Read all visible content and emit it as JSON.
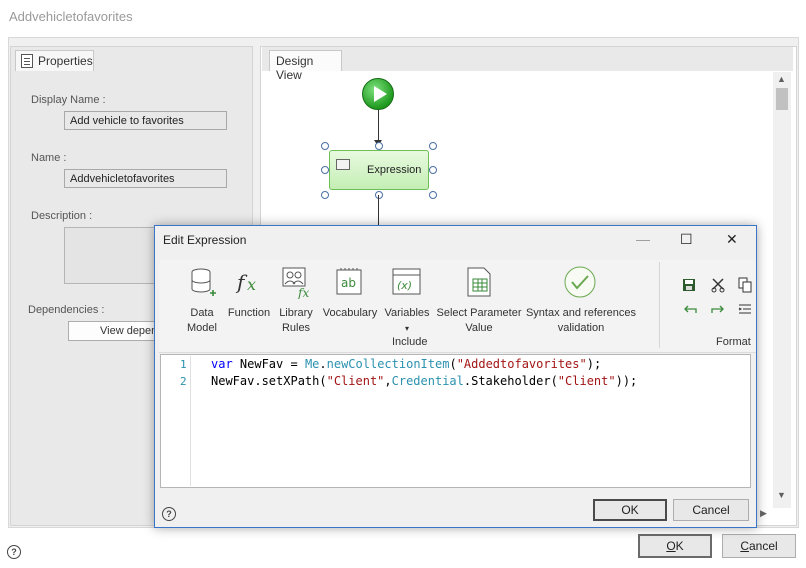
{
  "window": {
    "title": "Addvehicletofavorites",
    "ok_label": "OK",
    "ok_accel": "O",
    "ok_rest": "K",
    "cancel_label": "Cancel",
    "cancel_accel": "C",
    "cancel_rest": "ancel",
    "help_label": "?"
  },
  "properties": {
    "tab_label": "Properties",
    "display_name_label": "Display Name :",
    "display_name_value": "Add vehicle to favorites",
    "name_label": "Name :",
    "name_value": "Addvehicletofavorites",
    "description_label": "Description :",
    "dependencies_label": "Dependencies :",
    "view_dependencies_label": "View depen"
  },
  "design_view": {
    "tab_label": "Design View",
    "node_label": "Expression"
  },
  "dialog": {
    "title": "Edit Expression",
    "minimize_glyph": "—",
    "maximize_glyph": "☐",
    "close_glyph": "✕",
    "ribbon": {
      "data_model": "Data Model",
      "function": "Function",
      "library_rules": "Library Rules",
      "vocabulary": "Vocabulary",
      "variables": "Variables",
      "variables_arrow": "▾",
      "select_parameter_value": "Select Parameter Value",
      "syntax_validation": "Syntax and references validation",
      "include_group": "Include",
      "format_group": "Format"
    },
    "code_lines": [
      {
        "number": "1",
        "text": "var NewFav = Me.newCollectionItem(\"Addedtofavorites\");"
      },
      {
        "number": "2",
        "text": "NewFav.setXPath(\"Client\",Credential.Stakeholder(\"Client\"));"
      }
    ],
    "code_tokens": {
      "l1_var": "var",
      "l1_a": " NewFav = ",
      "l1_me": "Me",
      "l1_dot": ".",
      "l1_fn": "newCollectionItem",
      "l1_p1": "(",
      "l1_str": "\"Addedtofavorites\"",
      "l1_end": ");",
      "l2_a": "NewFav.setXPath(",
      "l2_str1": "\"Client\"",
      "l2_comma": ",",
      "l2_cred": "Credential",
      "l2_b": ".Stakeholder(",
      "l2_str2": "\"Client\"",
      "l2_end": "));"
    },
    "ok_label": "OK",
    "cancel_label": "Cancel",
    "help_label": "?"
  },
  "colors": {
    "accent": "#3874c8",
    "start_green": "#1f9a1f",
    "node_fill": "#c4eeb4",
    "keyword": "#0000ff",
    "string": "#a31515",
    "identifier": "#2b91af"
  },
  "icons": [
    "properties-icon",
    "start-icon",
    "expression-icon",
    "data-model-icon",
    "function-icon",
    "library-rules-icon",
    "vocabulary-icon",
    "variables-icon",
    "select-parameter-icon",
    "validation-icon",
    "save-icon",
    "cut-icon",
    "copy-icon",
    "undo-icon",
    "redo-icon",
    "indent-icon",
    "help-icon"
  ]
}
